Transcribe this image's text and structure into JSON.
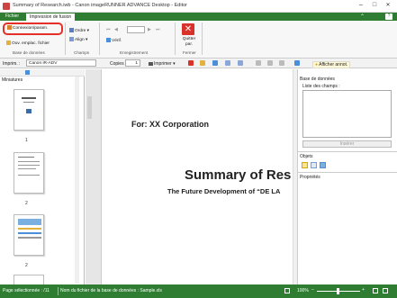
{
  "window": {
    "title": "Summary of Research.iwb - Canon imageRUNNER ADVANCE Desktop - Editor",
    "minimize": "–",
    "maximize": "□",
    "close": "✕"
  },
  "tabs": [
    {
      "label": "Fichier",
      "active": false
    },
    {
      "label": "Impression de fusion",
      "active": true
    }
  ],
  "help_label": "?",
  "ribbon": {
    "connection_button": "Connexion/param.",
    "open_source_button": "Ouv. emplac. fichier",
    "database_group": "Base de données",
    "order_button": "Ordre",
    "align_button": "Align",
    "fields_group": "Champs",
    "verify_button": "Vérif.",
    "record_group": "Enregistrement",
    "quit_button": "Quitter par.",
    "close_group": "Fermer"
  },
  "toolbar": {
    "print_label": "Imprim. :",
    "printer_value": "Canon iR-ADV",
    "copies_label": "Copies",
    "copies_value": "1",
    "print_button": "Imprimer",
    "show_annot_button": "Afficher annot."
  },
  "thumbnails": {
    "header": "Miniatures",
    "pages": [
      "1",
      "2",
      "2"
    ]
  },
  "document": {
    "for_line": "For: XX Corporation",
    "title": "Summary of Res",
    "subtitle": "The Future Development of “DE LA"
  },
  "right_panel": {
    "database_title": "Base de données",
    "field_list_label": "Liste des champs :",
    "insert_button": "Insérer",
    "objects_title": "Objets",
    "properties_title": "Propriétés"
  },
  "status": {
    "page_selected": "Page sélectionnée : /11",
    "db_file": "Nom du fichier de la base de données : Sample.xls",
    "zoom": "100%"
  },
  "colors": {
    "accent": "#2e7d32",
    "highlight": "#e5302a"
  }
}
